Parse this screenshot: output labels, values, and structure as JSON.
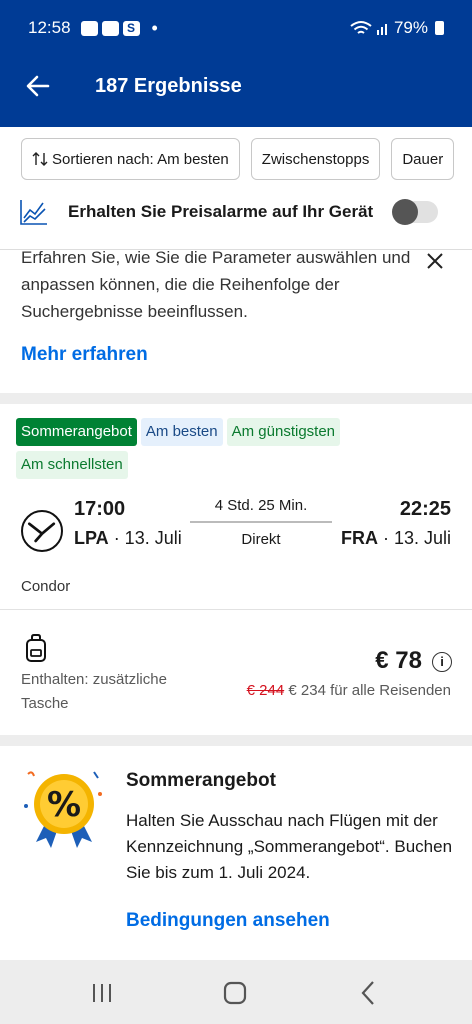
{
  "status": {
    "time": "12:58",
    "dot": "•",
    "battery": "79%"
  },
  "header": {
    "title": "187 Ergebnisse"
  },
  "filters": {
    "sort_label": "Sortieren nach: Am besten",
    "stops_label": "Zwischenstopps",
    "duration_label": "Dauer"
  },
  "price_alert": {
    "label": "Erhalten Sie Preisalarme auf Ihr Gerät",
    "enabled": false
  },
  "info_card": {
    "text": "Erfahren Sie, wie Sie die Parameter auswählen und anpassen können, die die Reihenfolge der Suchergebnisse beeinflussen.",
    "link": "Mehr erfahren"
  },
  "flight": {
    "badges": [
      "Sommerangebot",
      "Am besten",
      "Am günstigsten",
      "Am schnellsten"
    ],
    "departure_time": "17:00",
    "departure_airport": "LPA",
    "departure_date": "· 13. Juli",
    "arrival_time": "22:25",
    "arrival_airport": "FRA",
    "arrival_date": "· 13. Juli",
    "duration": "4 Std. 25 Min.",
    "stops": "Direkt",
    "airline": "Condor",
    "included": "Enthalten: zusätzliche Tasche",
    "price": "€ 78",
    "old_price": "€ 244",
    "total_price": "€ 234 für alle Reisenden"
  },
  "promo": {
    "title": "Sommerangebot",
    "text": "Halten Sie Ausschau nach Flügen mit der Kennzeichnung „Sommerangebot“. Buchen Sie bis zum 1. Juli 2024.",
    "link": "Bedingungen ansehen",
    "badge_symbol": "%"
  },
  "colors": {
    "brand": "#003b95",
    "link": "#006ce4",
    "deal": "#008234",
    "strike": "#d4111e"
  }
}
